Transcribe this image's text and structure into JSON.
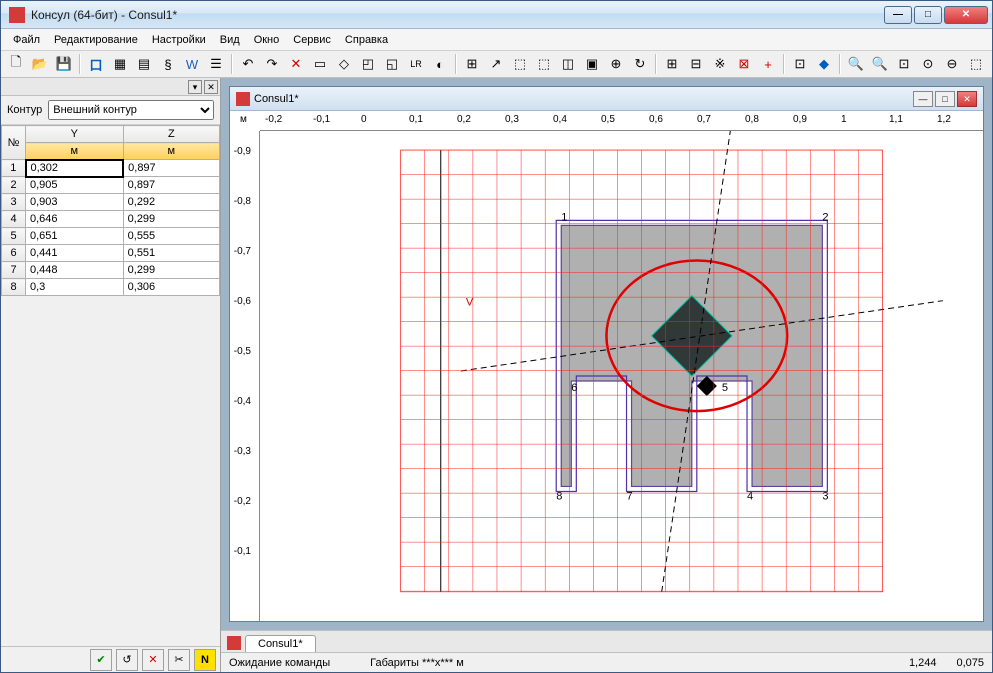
{
  "window": {
    "title": "Консул (64-бит) - Consul1*",
    "icon": "app-icon"
  },
  "menubar": [
    "Файл",
    "Редактирование",
    "Настройки",
    "Вид",
    "Окно",
    "Сервис",
    "Справка"
  ],
  "sidebar": {
    "contour_label": "Контур",
    "contour_value": "Внешний контур",
    "columns": {
      "n": "№",
      "y": "Y",
      "z": "Z",
      "unit": "м"
    },
    "rows": [
      {
        "n": 1,
        "y": "0,302",
        "z": "0,897"
      },
      {
        "n": 2,
        "y": "0,905",
        "z": "0,897"
      },
      {
        "n": 3,
        "y": "0,903",
        "z": "0,292"
      },
      {
        "n": 4,
        "y": "0,646",
        "z": "0,299"
      },
      {
        "n": 5,
        "y": "0,651",
        "z": "0,555"
      },
      {
        "n": 6,
        "y": "0,441",
        "z": "0,551"
      },
      {
        "n": 7,
        "y": "0,448",
        "z": "0,299"
      },
      {
        "n": 8,
        "y": "0,3",
        "z": "0,306"
      }
    ]
  },
  "canvas": {
    "title": "Consul1*",
    "ruler_h": [
      "-0,2",
      "-0,1",
      "0",
      "0,1",
      "0,2",
      "0,3",
      "0,4",
      "0,5",
      "0,6",
      "0,7",
      "0,8",
      "0,9",
      "1",
      "1,1",
      "1,2"
    ],
    "ruler_v": [
      "м",
      "-0,9",
      "-0,8",
      "-0,7",
      "-0,6",
      "-0,5",
      "-0,4",
      "-0,3",
      "-0,2",
      "-0,1"
    ],
    "axis_v_label": "V",
    "point_labels": [
      "1",
      "2",
      "3",
      "4",
      "5",
      "6",
      "7",
      "8"
    ]
  },
  "doctab": "Consul1*",
  "statusbar": {
    "wait": "Ожидание команды",
    "dims": "Габариты ***х*** м",
    "coord1": "1,244",
    "coord2": "0,075"
  },
  "chart_data": {
    "type": "scatter",
    "title": "Consul1*",
    "xlabel": "Y (м)",
    "ylabel": "Z (м)",
    "xlim": [
      -0.2,
      1.2
    ],
    "ylim": [
      -0.9,
      -0.1
    ],
    "series": [
      {
        "name": "Внешний контур",
        "x": [
          0.302,
          0.905,
          0.903,
          0.646,
          0.651,
          0.441,
          0.448,
          0.3
        ],
        "y": [
          0.897,
          0.897,
          0.292,
          0.299,
          0.555,
          0.551,
          0.299,
          0.306
        ]
      }
    ],
    "grid": true
  }
}
